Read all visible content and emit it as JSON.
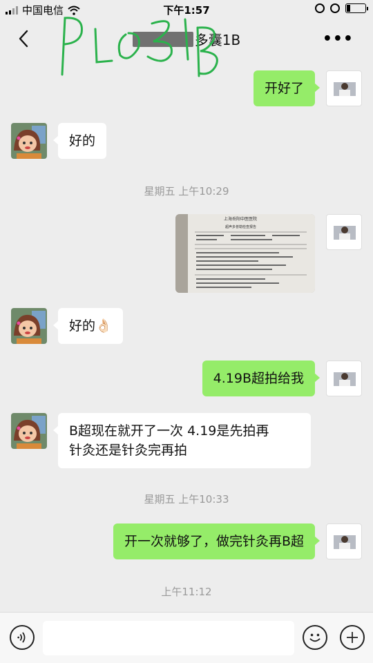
{
  "status_bar": {
    "carrier": "中国电信",
    "time": "下午1:57",
    "battery_level": 0.2
  },
  "nav": {
    "title": "多囊1B",
    "handwriting": "PLO31B"
  },
  "messages": [
    {
      "side": "out",
      "type": "text",
      "text": "开好了"
    },
    {
      "side": "in",
      "type": "text",
      "text": "好的"
    },
    {
      "type": "timestamp",
      "text": "星期五 上午10:29"
    },
    {
      "side": "out",
      "type": "image",
      "image_title": "上海岳阳中医医院",
      "image_subtitle": "超声多普勒检查报告"
    },
    {
      "side": "in",
      "type": "text",
      "text": "好的👌🏻"
    },
    {
      "side": "out",
      "type": "text",
      "text": "4.19B超拍给我"
    },
    {
      "side": "in",
      "type": "text",
      "text_line1": "B超现在就开了一次 4.19是先拍再",
      "text_line2": "针灸还是针灸完再拍"
    },
    {
      "type": "timestamp",
      "text": "星期五 上午10:33"
    },
    {
      "side": "out",
      "type": "text",
      "text": "开一次就够了，做完针灸再B超"
    },
    {
      "type": "timestamp",
      "text": "上午11:12"
    }
  ],
  "input": {
    "value": "",
    "placeholder": ""
  },
  "icons": {
    "back": "chevron-left-icon",
    "more": "more-dots-icon",
    "voice": "voice-icon",
    "emoji": "emoji-icon",
    "plus": "plus-icon"
  },
  "colors": {
    "background": "#ededed",
    "outgoing_bubble": "#95ec69",
    "incoming_bubble": "#ffffff",
    "scribble": "#2bb24c"
  }
}
